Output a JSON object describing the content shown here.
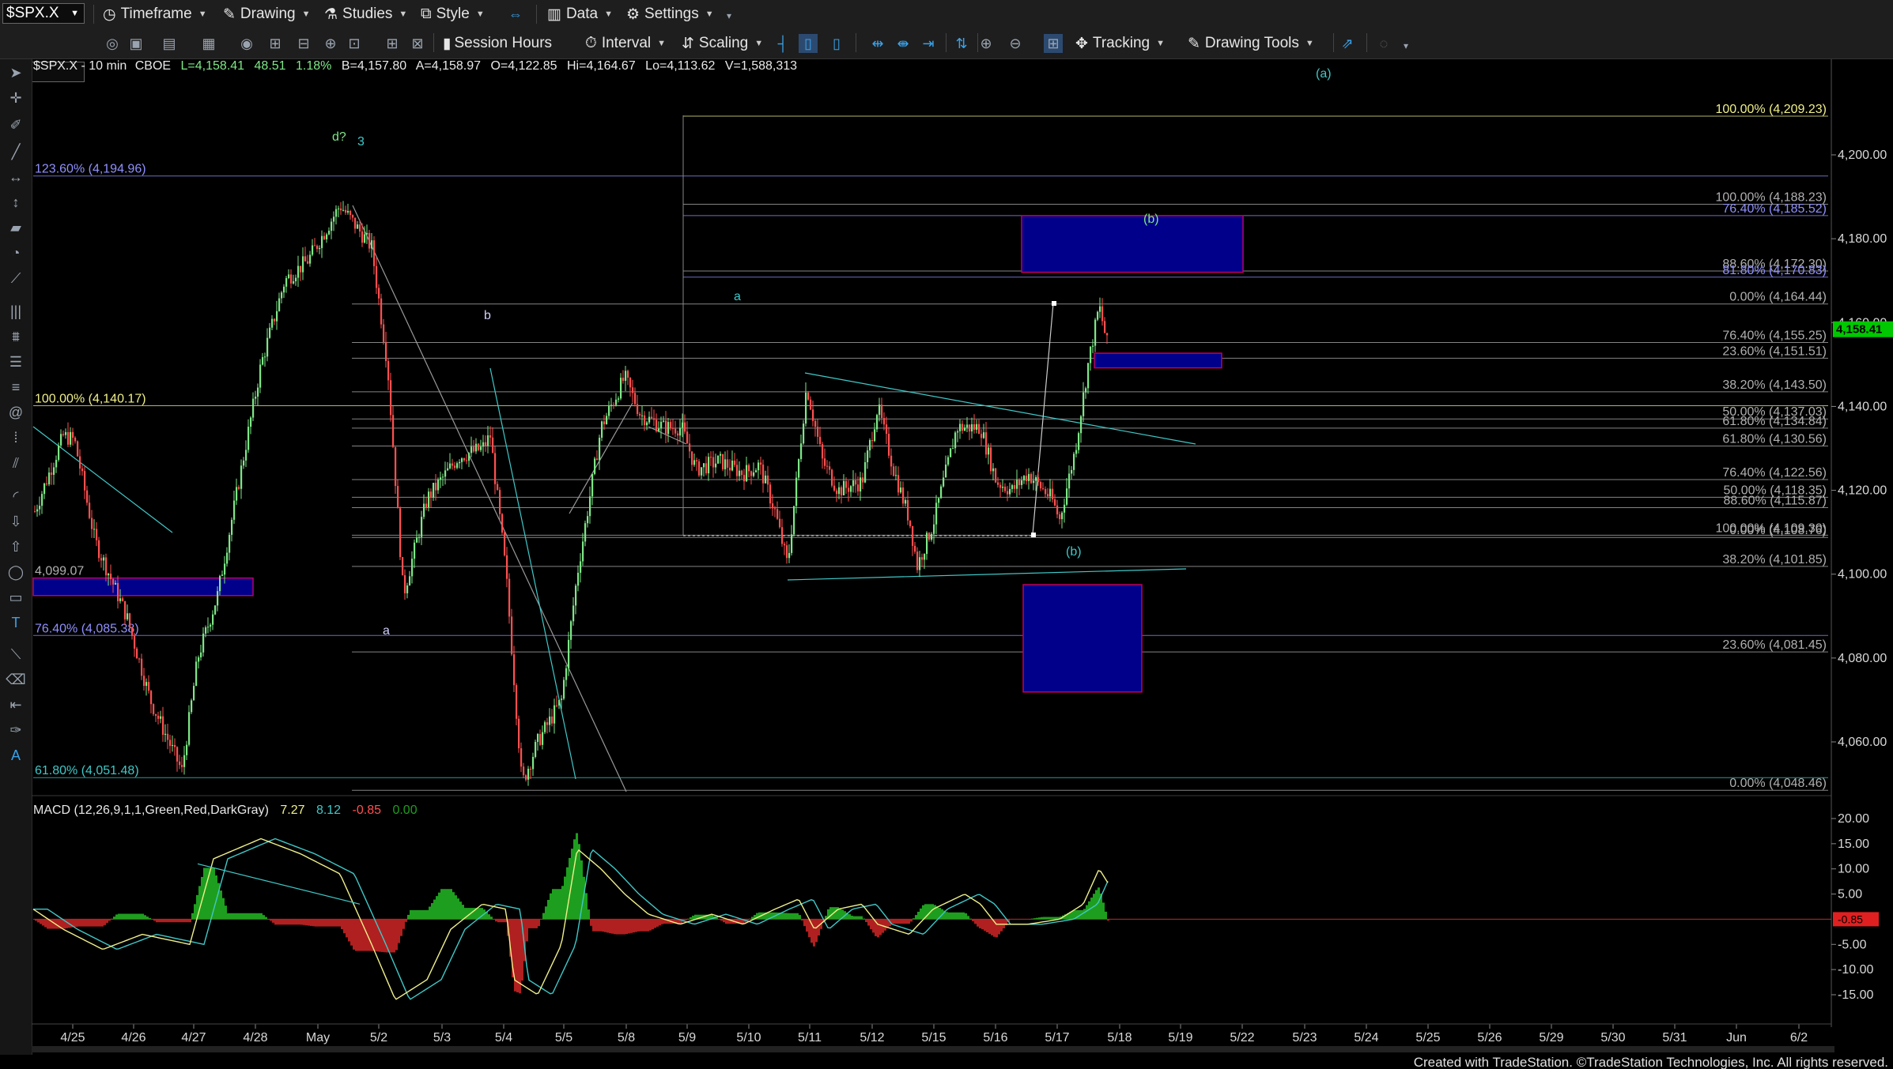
{
  "toolbar": {
    "symbol": "$SPX.X",
    "timeframe": "Timeframe",
    "drawing": "Drawing",
    "studies": "Studies",
    "style": "Style",
    "data": "Data",
    "settings": "Settings",
    "session_hours": "Session Hours",
    "interval": "Interval",
    "scaling": "Scaling",
    "tracking": "Tracking",
    "drawing_tools": "Drawing Tools"
  },
  "header": {
    "symbol": "$SPX.X - 10 min",
    "exchange": "CBOE",
    "last": "L=4,158.41",
    "change": "48.51",
    "change_pct": "1.18%",
    "bid": "B=4,157.80",
    "ask": "A=4,158.97",
    "open": "O=4,122.85",
    "high": "Hi=4,164.67",
    "low": "Lo=4,113.62",
    "volume": "V=1,588,313"
  },
  "colors": {
    "up": "#7ee787",
    "down": "#ff5050",
    "fib": "#f0f08a",
    "box_fill": "#00008b",
    "box_border": "#c00060",
    "trendline": "#40c8c8",
    "price_tag": "#00c800",
    "macd_tag": "#e02020"
  },
  "price_axis": {
    "ticks": [
      "4,200.00",
      "4,180.00",
      "4,160.00",
      "4,140.00",
      "4,120.00",
      "4,100.00",
      "4,080.00",
      "4,060.00"
    ],
    "last_price": "4,158.41"
  },
  "time_axis": {
    "labels": [
      "4/25",
      "4/26",
      "4/27",
      "4/28",
      "May",
      "5/2",
      "5/3",
      "5/4",
      "5/5",
      "5/8",
      "5/9",
      "5/10",
      "5/11",
      "5/12",
      "5/15",
      "5/16",
      "5/17",
      "5/18",
      "5/19",
      "5/22",
      "5/23",
      "5/24",
      "5/25",
      "5/26",
      "5/29",
      "5/30",
      "5/31",
      "Jun",
      "6/2"
    ]
  },
  "fib_labels": [
    {
      "text": "100.00% (4,209.23)",
      "price": 4209.23,
      "color": "#f0f08a"
    },
    {
      "text": "100.00% (4,188.23)",
      "price": 4188.23,
      "color": "#b0b0b0"
    },
    {
      "text": "76.40% (4,185.52)",
      "price": 4185.52,
      "color": "#9090ff"
    },
    {
      "text": "88.60% (4,172.30)",
      "price": 4172.3,
      "color": "#b0b0b0"
    },
    {
      "text": "81.80% (4,170.83)",
      "price": 4170.83,
      "color": "#9090ff"
    },
    {
      "text": "0.00% (4,164.44)",
      "price": 4164.44,
      "color": "#b0b0b0"
    },
    {
      "text": "76.40% (4,155.25)",
      "price": 4155.25,
      "color": "#b0b0b0"
    },
    {
      "text": "23.60% (4,151.51)",
      "price": 4151.51,
      "color": "#b0b0b0"
    },
    {
      "text": "38.20% (4,143.50)",
      "price": 4143.5,
      "color": "#b0b0b0"
    },
    {
      "text": "50.00% (4,137.03)",
      "price": 4137.03,
      "color": "#b0b0b0"
    },
    {
      "text": "61.80% (4,134.84)",
      "price": 4134.84,
      "color": "#b0b0b0"
    },
    {
      "text": "61.80% (4,130.56)",
      "price": 4130.56,
      "color": "#b0b0b0"
    },
    {
      "text": "76.40% (4,122.56)",
      "price": 4122.56,
      "color": "#b0b0b0"
    },
    {
      "text": "50.00% (4,118.35)",
      "price": 4118.35,
      "color": "#b0b0b0"
    },
    {
      "text": "88.60% (4,115.87)",
      "price": 4115.87,
      "color": "#b0b0b0"
    },
    {
      "text": "100.00% (4,109.30)",
      "price": 4109.3,
      "color": "#b0b0b0"
    },
    {
      "text": "0.00% (4,108.76)",
      "price": 4108.76,
      "color": "#b0b0b0"
    },
    {
      "text": "38.20% (4,101.85)",
      "price": 4101.85,
      "color": "#b0b0b0"
    },
    {
      "text": "23.60% (4,081.45)",
      "price": 4081.45,
      "color": "#b0b0b0"
    },
    {
      "text": "0.00% (4,048.46)",
      "price": 4048.46,
      "color": "#b0b0b0"
    }
  ],
  "left_labels": [
    {
      "text": "123.60% (4,194.96)",
      "price": 4194.96,
      "color": "#9090ff"
    },
    {
      "text": "100.00% (4,140.17)",
      "price": 4140.17,
      "color": "#f0f08a"
    },
    {
      "text": "4,099.07",
      "price": 4099.07,
      "color": "#b0b0b0"
    },
    {
      "text": "76.40% (4,085.38)",
      "price": 4085.38,
      "color": "#9090ff"
    },
    {
      "text": "61.80% (4,051.48)",
      "price": 4051.48,
      "color": "#40c8c8"
    }
  ],
  "wave_labels": [
    {
      "text": "(a)",
      "color": "#40c8c8"
    },
    {
      "text": "d?",
      "color": "#7ee787"
    },
    {
      "text": "3",
      "color": "#40c8c8"
    },
    {
      "text": "b",
      "color": "#d0d0ff"
    },
    {
      "text": "a",
      "color": "#40c8c8"
    },
    {
      "text": "(b)",
      "color": "#7ee787"
    },
    {
      "text": "(b)",
      "color": "#40c8c8"
    },
    {
      "text": "a",
      "color": "#d0d0ff"
    }
  ],
  "macd": {
    "title": "MACD (12,26,9,1,1,Green,Red,DarkGray)",
    "macd": "7.27",
    "signal": "8.12",
    "diff": "-0.85",
    "zero": "0.00",
    "ticks": [
      "20.00",
      "15.00",
      "10.00",
      "5.00",
      "-5.00",
      "-10.00",
      "-15.00"
    ],
    "last_tag": "-0.85"
  },
  "footer": {
    "copyright": "Created with TradeStation. ©TradeStation Technologies, Inc. All rights reserved."
  }
}
